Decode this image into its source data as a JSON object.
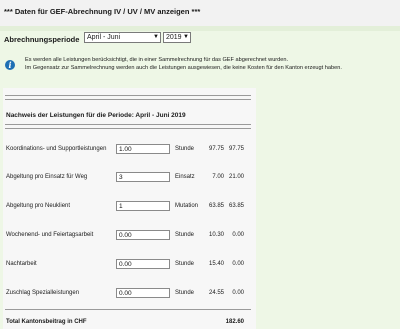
{
  "header": {
    "title": "*** Daten für GEF-Abrechnung IV / UV / MV anzeigen ***"
  },
  "period": {
    "label": "Abrechnungsperiode",
    "quarter": "April - Juni",
    "year": "2019"
  },
  "info": {
    "icon": "info-icon",
    "line1": "Es werden alle Leistungen berücksichtigt, die in einer Sammelrechnung für das GEF abgerechnet wurden.",
    "line2": "Im Gegensatz zur Sammelrechnung werden auch die Leistungen ausgewiesen, die keine Kosten für den Kanton erzeugt haben."
  },
  "summary": {
    "heading": "Nachweis der Leistungen für die Periode: April - Juni 2019",
    "rows": [
      {
        "label": "Koordinations- und Supportleistungen",
        "quantity": "1.00",
        "unit": "Stunde",
        "price": "97.75",
        "amount": "97.75"
      },
      {
        "label": "Abgeltung pro Einsatz für Weg",
        "quantity": "3",
        "unit": "Einsatz",
        "price": "7.00",
        "amount": "21.00"
      },
      {
        "label": "Abgeltung pro Neuklient",
        "quantity": "1",
        "unit": "Mutation",
        "price": "63.85",
        "amount": "63.85"
      },
      {
        "label": "Wochenend- und Feiertagsarbeit",
        "quantity": "0.00",
        "unit": "Stunde",
        "price": "10.30",
        "amount": "0.00"
      },
      {
        "label": "Nachtarbeit",
        "quantity": "0.00",
        "unit": "Stunde",
        "price": "15.40",
        "amount": "0.00"
      },
      {
        "label": "Zuschlag Spezialleistungen",
        "quantity": "0.00",
        "unit": "Stunde",
        "price": "24.55",
        "amount": "0.00"
      }
    ],
    "total_label": "Total Kantonsbeitrag in CHF",
    "total_value": "182.60"
  }
}
